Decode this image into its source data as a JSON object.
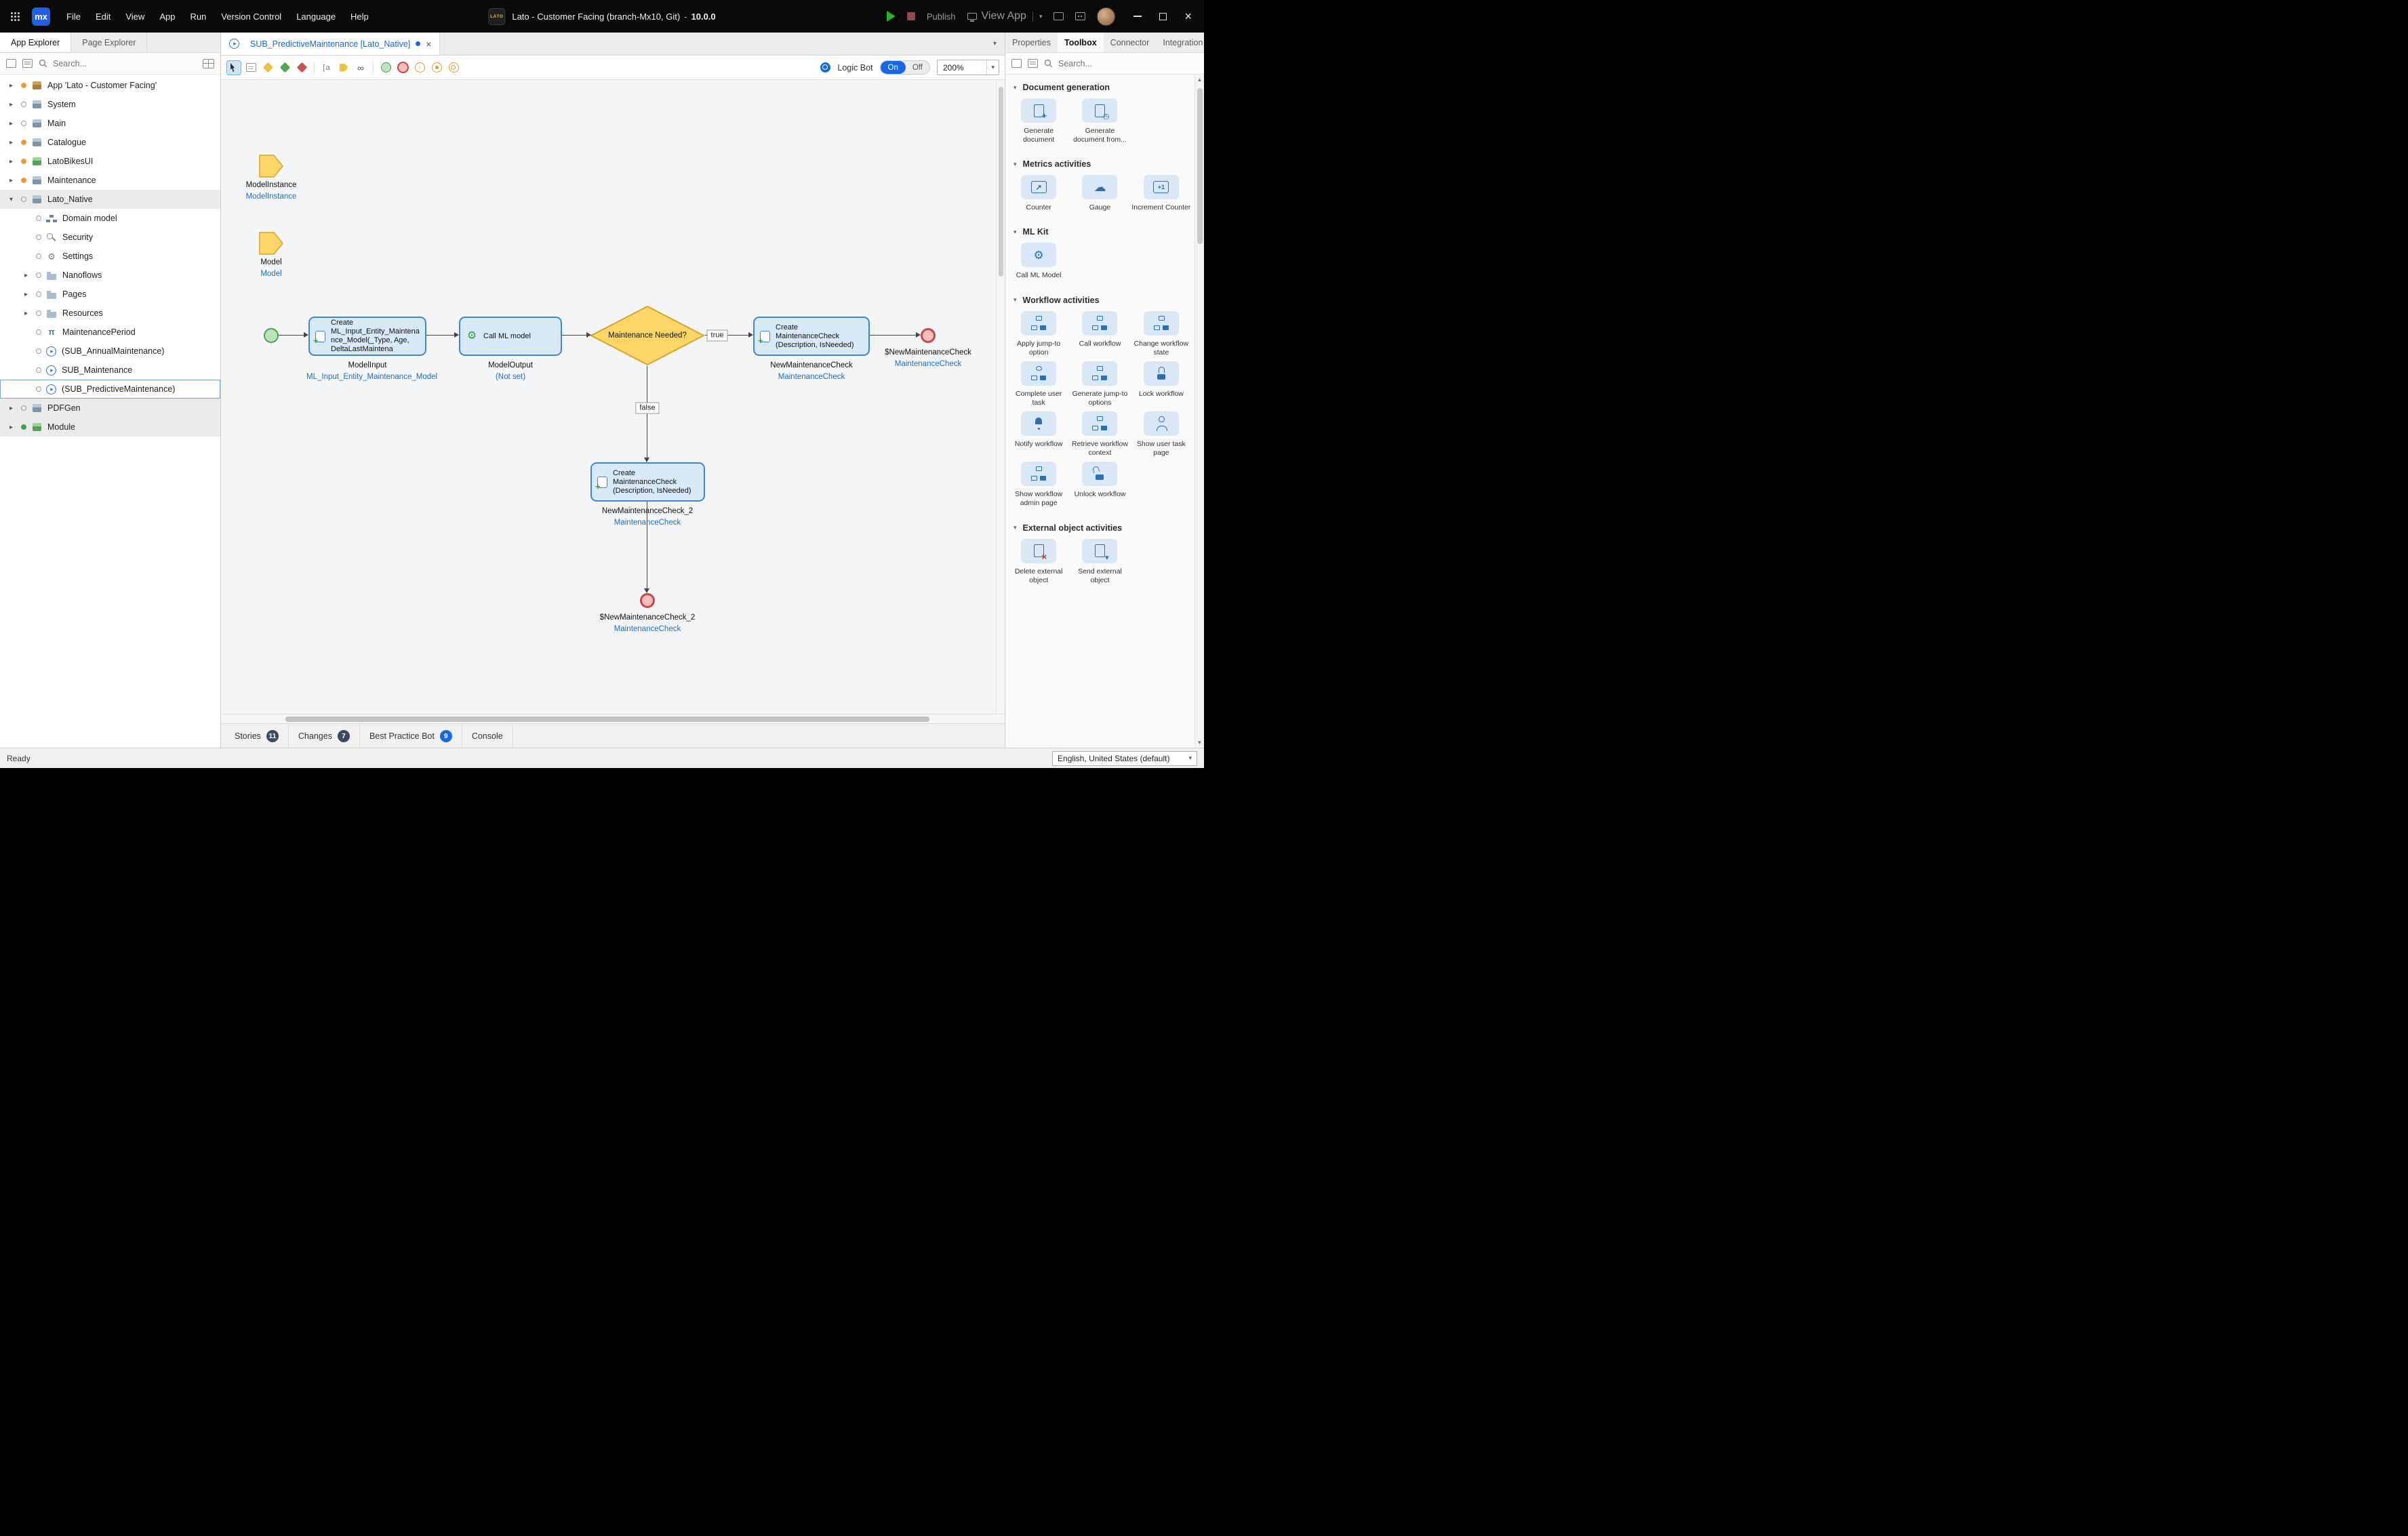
{
  "colors": {
    "accent_blue": "#1769e0",
    "activity_fill": "#d8e9fa",
    "activity_border": "#3f86d2",
    "decision_fill": "#fcd667",
    "decision_border": "#dba32c",
    "start_fill": "#b7e3b7",
    "start_border": "#4d9e4d",
    "end_fill": "#f6bdbd",
    "end_border": "#c64848",
    "link_blue": "#1a70c2",
    "badge_dark": "#3a4a63",
    "toolbox_tile": "#d9e7f6"
  },
  "titlebar": {
    "logo_text": "mx",
    "app_badge": "LATO",
    "title_main": "Lato - Customer Facing (branch-Mx10, Git)",
    "title_sep": "-",
    "version": "10.0.0",
    "publish_label": "Publish",
    "view_app_label": "View App",
    "menus": [
      {
        "label": "File",
        "name": "menu-file"
      },
      {
        "label": "Edit",
        "name": "menu-edit"
      },
      {
        "label": "View",
        "name": "menu-view"
      },
      {
        "label": "App",
        "name": "menu-app"
      },
      {
        "label": "Run",
        "name": "menu-run"
      },
      {
        "label": "Version Control",
        "name": "menu-version-control"
      },
      {
        "label": "Language",
        "name": "menu-language"
      },
      {
        "label": "Help",
        "name": "menu-help"
      }
    ]
  },
  "left_panel": {
    "tabs": [
      {
        "label": "App Explorer",
        "cls": "active",
        "name": "explorer-tab-app"
      },
      {
        "label": "Page Explorer",
        "cls": "",
        "name": "explorer-tab-page"
      }
    ],
    "search_placeholder": "Search...",
    "tree": [
      {
        "label": "App 'Lato - Customer Facing'",
        "chev": "▸",
        "cls": "lvl0",
        "dot": "dot-orange",
        "icon": "i-app",
        "name": "tree-item-app-root"
      },
      {
        "label": "System",
        "chev": "▸",
        "cls": "lvl0",
        "dot": "dot-outline",
        "icon": "i-module",
        "name": "tree-item-system"
      },
      {
        "label": "Main",
        "chev": "▸",
        "cls": "lvl0",
        "dot": "dot-outline",
        "icon": "i-module",
        "name": "tree-item-main"
      },
      {
        "label": "Catalogue",
        "chev": "▸",
        "cls": "lvl0",
        "dot": "dot-orange",
        "icon": "i-module",
        "name": "tree-item-catalogue"
      },
      {
        "label": "LatoBikesUI",
        "chev": "▸",
        "cls": "lvl0",
        "dot": "dot-orange",
        "icon": "i-module-green",
        "name": "tree-item-latobikesui"
      },
      {
        "label": "Maintenance",
        "chev": "▸",
        "cls": "lvl0",
        "dot": "dot-orange",
        "icon": "i-module",
        "name": "tree-item-maintenance"
      },
      {
        "label": "Lato_Native",
        "chev": "▾",
        "cls": "lvl0 shaded",
        "dot": "dot-outline",
        "icon": "i-module",
        "name": "tree-item-lato-native"
      },
      {
        "label": "Domain model",
        "chev": "",
        "cls": "lvl1",
        "dot": "dot-outline",
        "icon": "i-domain",
        "name": "tree-item-domain-model"
      },
      {
        "label": "Security",
        "chev": "",
        "cls": "lvl1",
        "dot": "dot-outline",
        "icon": "i-security",
        "name": "tree-item-security"
      },
      {
        "label": "Settings",
        "chev": "",
        "cls": "lvl1",
        "dot": "dot-outline",
        "icon": "i-settings",
        "name": "tree-item-settings"
      },
      {
        "label": "Nanoflows",
        "chev": "▸",
        "cls": "lvl1",
        "dot": "dot-outline",
        "icon": "i-folder",
        "name": "tree-item-nanoflows"
      },
      {
        "label": "Pages",
        "chev": "▸",
        "cls": "lvl1",
        "dot": "dot-outline",
        "icon": "i-folder",
        "name": "tree-item-pages"
      },
      {
        "label": "Resources",
        "chev": "▸",
        "cls": "lvl1",
        "dot": "dot-outline",
        "icon": "i-folder",
        "name": "tree-item-resources"
      },
      {
        "label": "MaintenancePeriod",
        "chev": "",
        "cls": "lvl1",
        "dot": "dot-outline",
        "icon": "i-pi",
        "name": "tree-item-maintenanceperiod"
      },
      {
        "label": "(SUB_AnnualMaintenance)",
        "chev": "",
        "cls": "lvl1",
        "dot": "dot-outline",
        "icon": "i-microflow",
        "name": "tree-item-sub-annualmaintenance"
      },
      {
        "label": "SUB_Maintenance",
        "chev": "",
        "cls": "lvl1",
        "dot": "dot-outline",
        "icon": "i-microflow",
        "name": "tree-item-sub-maintenance"
      },
      {
        "label": "(SUB_PredictiveMaintenance)",
        "chev": "",
        "cls": "lvl1 selected",
        "dot": "dot-outline",
        "icon": "i-microflow",
        "name": "tree-item-sub-predictivemaintenance"
      },
      {
        "label": "PDFGen",
        "chev": "▸",
        "cls": "lvl0 shaded",
        "dot": "dot-outline",
        "icon": "i-module",
        "name": "tree-item-pdfgen"
      },
      {
        "label": "Module",
        "chev": "▸",
        "cls": "lvl0 shaded",
        "dot": "dot-green",
        "icon": "i-module-green",
        "name": "tree-item-module"
      }
    ]
  },
  "editor": {
    "tab": {
      "label": "SUB_PredictiveMaintenance [Lato_Native]"
    },
    "toolbar": {
      "logic_bot": "Logic Bot",
      "on": "On",
      "off": "Off",
      "zoom": "200%",
      "tools": [
        {
          "cls": "tool-select active",
          "name": "select-tool-icon"
        },
        {
          "cls": "tool-note",
          "name": "annotation-tool-icon"
        },
        {
          "cls": "tool-dec tool-y",
          "name": "decision-tool-icon"
        },
        {
          "cls": "tool-dec tool-g",
          "name": "merge-tool-icon"
        },
        {
          "cls": "tool-dec tool-r",
          "name": "error-event-tool-icon"
        },
        {
          "cls": "tool-sep",
          "name": "toolbar-separator"
        },
        {
          "cls": "tool-text",
          "name": "text-annotation-tool-icon"
        },
        {
          "cls": "tool-param",
          "name": "parameter-tool-icon"
        },
        {
          "cls": "tool-loop",
          "name": "loop-tool-icon"
        },
        {
          "cls": "tool-sep",
          "name": "toolbar-separator"
        },
        {
          "cls": "tool-circ tool-start",
          "name": "start-event-tool-icon"
        },
        {
          "cls": "tool-circ tool-end",
          "name": "end-event-tool-icon"
        },
        {
          "cls": "tool-circ tool-cont",
          "name": "continue-event-tool-icon"
        },
        {
          "cls": "tool-circ tool-brk",
          "name": "break-event-tool-icon"
        },
        {
          "cls": "tool-circ tool-dbl",
          "name": "timer-event-tool-icon"
        }
      ]
    },
    "flow": {
      "param1": {
        "caption": "ModelInstance",
        "type": "ModelInstance"
      },
      "param2": {
        "caption": "Model",
        "type": "Model"
      },
      "act1": {
        "text": "Create ML_Input_Entity_Maintenance_Model(_Type, Age, DeltaLastMaintena",
        "caption": "ModelInput",
        "link": "ML_Input_Entity_Maintenance_Model"
      },
      "act2": {
        "text": "Call ML model",
        "caption": "ModelOutput",
        "link": "(Not set)"
      },
      "decision": {
        "text": "Maintenance Needed?",
        "true_label": "true",
        "false_label": "false"
      },
      "act3": {
        "text": "Create MaintenanceCheck (Description, IsNeeded)",
        "caption": "NewMaintenanceCheck",
        "link": "MaintenanceCheck"
      },
      "end1": {
        "caption": "$NewMaintenanceCheck",
        "link": "MaintenanceCheck"
      },
      "act4": {
        "text": "Create MaintenanceCheck (Description, IsNeeded)",
        "caption": "NewMaintenanceCheck_2",
        "link": "MaintenanceCheck"
      },
      "end2": {
        "caption": "$NewMaintenanceCheck_2",
        "link": "MaintenanceCheck"
      }
    },
    "bottom_tabs": [
      {
        "label": "Stories",
        "badge": "11",
        "badge_cls": "b-dark",
        "name": "bottom-tab-stories"
      },
      {
        "label": "Changes",
        "badge": "7",
        "badge_cls": "b-dark",
        "name": "bottom-tab-changes"
      },
      {
        "label": "Best Practice Bot",
        "badge": "9",
        "badge_cls": "b-blue",
        "name": "bottom-tab-best-practice-bot"
      },
      {
        "label": "Console",
        "badge": "",
        "badge_cls": "",
        "name": "bottom-tab-console"
      }
    ]
  },
  "right_panel": {
    "tabs": [
      {
        "label": "Properties",
        "cls": "",
        "name": "panel-tab-properties"
      },
      {
        "label": "Toolbox",
        "cls": "active",
        "name": "panel-tab-toolbox"
      },
      {
        "label": "Connector",
        "cls": "",
        "name": "panel-tab-connector"
      },
      {
        "label": "Integration",
        "cls": "",
        "name": "panel-tab-integration"
      }
    ],
    "search_placeholder": "Search...",
    "sections": [
      {
        "title": "Document generation",
        "items": [
          {
            "label": "Generate document",
            "icon": "ic-doc-plus",
            "name": "toolbox-item-generate-document"
          },
          {
            "label": "Generate document from...",
            "icon": "ic-doc-clock",
            "name": "toolbox-item-generate-document-from"
          }
        ]
      },
      {
        "title": "Metrics activities",
        "items": [
          {
            "label": "Counter",
            "icon": "ic-chart",
            "name": "toolbox-item-counter"
          },
          {
            "label": "Gauge",
            "icon": "ic-gauge",
            "name": "toolbox-item-gauge"
          },
          {
            "label": "Increment Counter",
            "icon": "ic-chart-plus",
            "name": "toolbox-item-increment-counter"
          }
        ]
      },
      {
        "title": "ML Kit",
        "items": [
          {
            "label": "Call ML Model",
            "icon": "ic-ml",
            "name": "toolbox-item-call-ml-model"
          }
        ]
      },
      {
        "title": "Workflow activities",
        "items": [
          {
            "label": "Apply jump-to option",
            "icon": "ic-flow",
            "name": "toolbox-item-apply-jump-to-option"
          },
          {
            "label": "Call workflow",
            "icon": "ic-flow",
            "name": "toolbox-item-call-workflow"
          },
          {
            "label": "Change workflow state",
            "icon": "ic-flow",
            "name": "toolbox-item-change-workflow-state"
          },
          {
            "label": "Complete user task",
            "icon": "ic-flow-check",
            "name": "toolbox-item-complete-user-task"
          },
          {
            "label": "Generate jump-to options",
            "icon": "ic-flow",
            "name": "toolbox-item-generate-jump-to-options"
          },
          {
            "label": "Lock workflow",
            "icon": "ic-lock",
            "name": "toolbox-item-lock-workflow"
          },
          {
            "label": "Notify workflow",
            "icon": "ic-bell",
            "name": "toolbox-item-notify-workflow"
          },
          {
            "label": "Retrieve workflow context",
            "icon": "ic-flow",
            "name": "toolbox-item-retrieve-workflow-context"
          },
          {
            "label": "Show user task page",
            "icon": "ic-user",
            "name": "toolbox-item-show-user-task-page"
          },
          {
            "label": "Show workflow admin page",
            "icon": "ic-flow",
            "name": "toolbox-item-show-workflow-admin-page"
          },
          {
            "label": "Unlock workflow",
            "icon": "ic-unlock",
            "name": "toolbox-item-unlock-workflow"
          }
        ]
      },
      {
        "title": "External object activities",
        "items": [
          {
            "label": "Delete external object",
            "icon": "ic-doc-delete",
            "name": "toolbox-item-delete-external-object"
          },
          {
            "label": "Send external object",
            "icon": "ic-doc-send",
            "name": "toolbox-item-send-external-object"
          }
        ]
      }
    ]
  },
  "status_bar": {
    "ready": "Ready",
    "language": "English, United States (default)"
  }
}
